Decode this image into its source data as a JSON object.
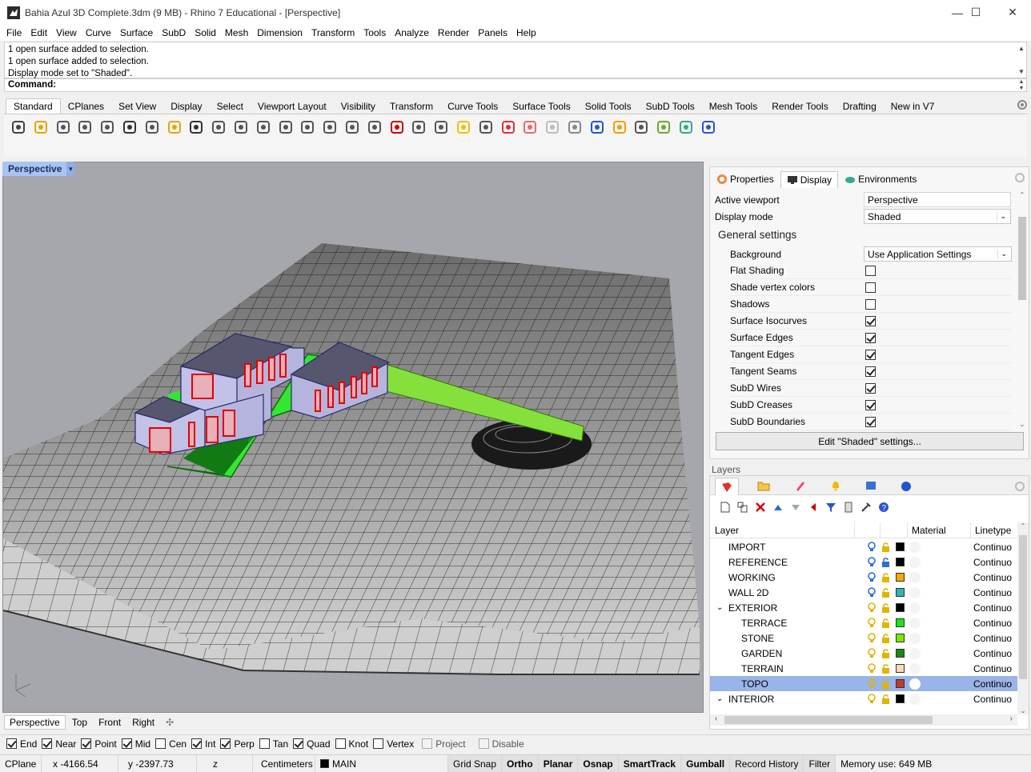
{
  "window": {
    "title": "Bahia Azul 3D Complete.3dm (9 MB) - Rhino 7 Educational - [Perspective]"
  },
  "menu": [
    "File",
    "Edit",
    "View",
    "Curve",
    "Surface",
    "SubD",
    "Solid",
    "Mesh",
    "Dimension",
    "Transform",
    "Tools",
    "Analyze",
    "Render",
    "Panels",
    "Help"
  ],
  "command": {
    "history": [
      "1 open surface added to selection.",
      "1 open surface added to selection.",
      "Display mode set to \"Shaded\"."
    ],
    "prompt": "Command:"
  },
  "toolbar_tabs": [
    "Standard",
    "CPlanes",
    "Set View",
    "Display",
    "Select",
    "Viewport Layout",
    "Visibility",
    "Transform",
    "Curve Tools",
    "Surface Tools",
    "Solid Tools",
    "SubD Tools",
    "Mesh Tools",
    "Render Tools",
    "Drafting",
    "New in V7"
  ],
  "toolbar_icons": [
    "new-icon",
    "open-icon",
    "save-icon",
    "print-icon",
    "export-icon",
    "cut-icon",
    "copy-icon",
    "paste-icon",
    "undo-icon",
    "pan-icon",
    "rotate-view-icon",
    "zoom-icon",
    "zoom-window-icon",
    "zoom-extents-icon",
    "zoom-selected-icon",
    "viewport-rotate-icon",
    "four-viewports-icon",
    "car-icon",
    "cplane-icon",
    "grid-icon",
    "light-icon",
    "lock-icon",
    "layer-icon",
    "color-wheel-icon",
    "wireframe-sphere-icon",
    "shaded-sphere-icon",
    "rendered-sphere-icon",
    "sun-icon",
    "gear-icon",
    "gumball-icon",
    "render-icon",
    "help-icon"
  ],
  "viewport": {
    "name": "Perspective",
    "tabs": [
      "Perspective",
      "Top",
      "Front",
      "Right"
    ]
  },
  "osnaps": [
    {
      "label": "End",
      "checked": true
    },
    {
      "label": "Near",
      "checked": true
    },
    {
      "label": "Point",
      "checked": true
    },
    {
      "label": "Mid",
      "checked": true
    },
    {
      "label": "Cen",
      "checked": false
    },
    {
      "label": "Int",
      "checked": true
    },
    {
      "label": "Perp",
      "checked": true
    },
    {
      "label": "Tan",
      "checked": false
    },
    {
      "label": "Quad",
      "checked": true
    },
    {
      "label": "Knot",
      "checked": false
    },
    {
      "label": "Vertex",
      "checked": false
    },
    {
      "label": "Project",
      "checked": false
    },
    {
      "label": "Disable",
      "checked": false
    }
  ],
  "status": {
    "cplane": "CPlane",
    "x": "x -4166.54",
    "y": "y -2397.73",
    "z": "z",
    "units": "Centimeters",
    "layer": "MAIN",
    "grid_snap": "Grid Snap",
    "ortho": "Ortho",
    "planar": "Planar",
    "osnap": "Osnap",
    "smarttrack": "SmartTrack",
    "gumball": "Gumball",
    "record_history": "Record History",
    "filter": "Filter",
    "memory": "Memory use: 649 MB"
  },
  "properties_panel": {
    "tabs": [
      "Properties",
      "Display",
      "Environments"
    ],
    "active_viewport_label": "Active viewport",
    "active_viewport_value": "Perspective",
    "display_mode_label": "Display mode",
    "display_mode_value": "Shaded",
    "general_settings": "General settings",
    "background_label": "Background",
    "background_value": "Use Application Settings",
    "settings": [
      {
        "label": "Flat Shading",
        "checked": false
      },
      {
        "label": "Shade vertex colors",
        "checked": false
      },
      {
        "label": "Shadows",
        "checked": false
      },
      {
        "label": "Surface Isocurves",
        "checked": true
      },
      {
        "label": "Surface Edges",
        "checked": true
      },
      {
        "label": "Tangent Edges",
        "checked": true
      },
      {
        "label": "Tangent Seams",
        "checked": true
      },
      {
        "label": "SubD Wires",
        "checked": true
      },
      {
        "label": "SubD Creases",
        "checked": true
      },
      {
        "label": "SubD Boundaries",
        "checked": true
      }
    ],
    "edit_button": "Edit \"Shaded\" settings..."
  },
  "layers_panel": {
    "title": "Layers",
    "columns": {
      "layer": "Layer",
      "material": "Material",
      "linetype": "Linetype"
    },
    "layers": [
      {
        "name": "IMPORT",
        "color": "#000000",
        "level": 0,
        "linetype": "Continuo"
      },
      {
        "name": "REFERENCE",
        "color": "#000000",
        "level": 0,
        "linetype": "Continuo"
      },
      {
        "name": "WORKING",
        "color": "#f2a900",
        "level": 0,
        "linetype": "Continuo"
      },
      {
        "name": "WALL 2D",
        "color": "#2fb3b3",
        "level": 0,
        "linetype": "Continuo"
      },
      {
        "name": "EXTERIOR",
        "color": "#000000",
        "level": 0,
        "expanded": true,
        "linetype": "Continuo"
      },
      {
        "name": "TERRACE",
        "color": "#19e619",
        "level": 1,
        "linetype": "Continuo"
      },
      {
        "name": "STONE",
        "color": "#7fe600",
        "level": 1,
        "linetype": "Continuo"
      },
      {
        "name": "GARDEN",
        "color": "#138a13",
        "level": 1,
        "linetype": "Continuo"
      },
      {
        "name": "TERRAIN",
        "color": "#f7dcb4",
        "level": 1,
        "linetype": "Continuo"
      },
      {
        "name": "TOPO",
        "color": "#c0392b",
        "level": 1,
        "selected": true,
        "linetype": "Continuo"
      },
      {
        "name": "INTERIOR",
        "color": "#000000",
        "level": 0,
        "expanded": true,
        "linetype": "Continuo"
      }
    ]
  }
}
